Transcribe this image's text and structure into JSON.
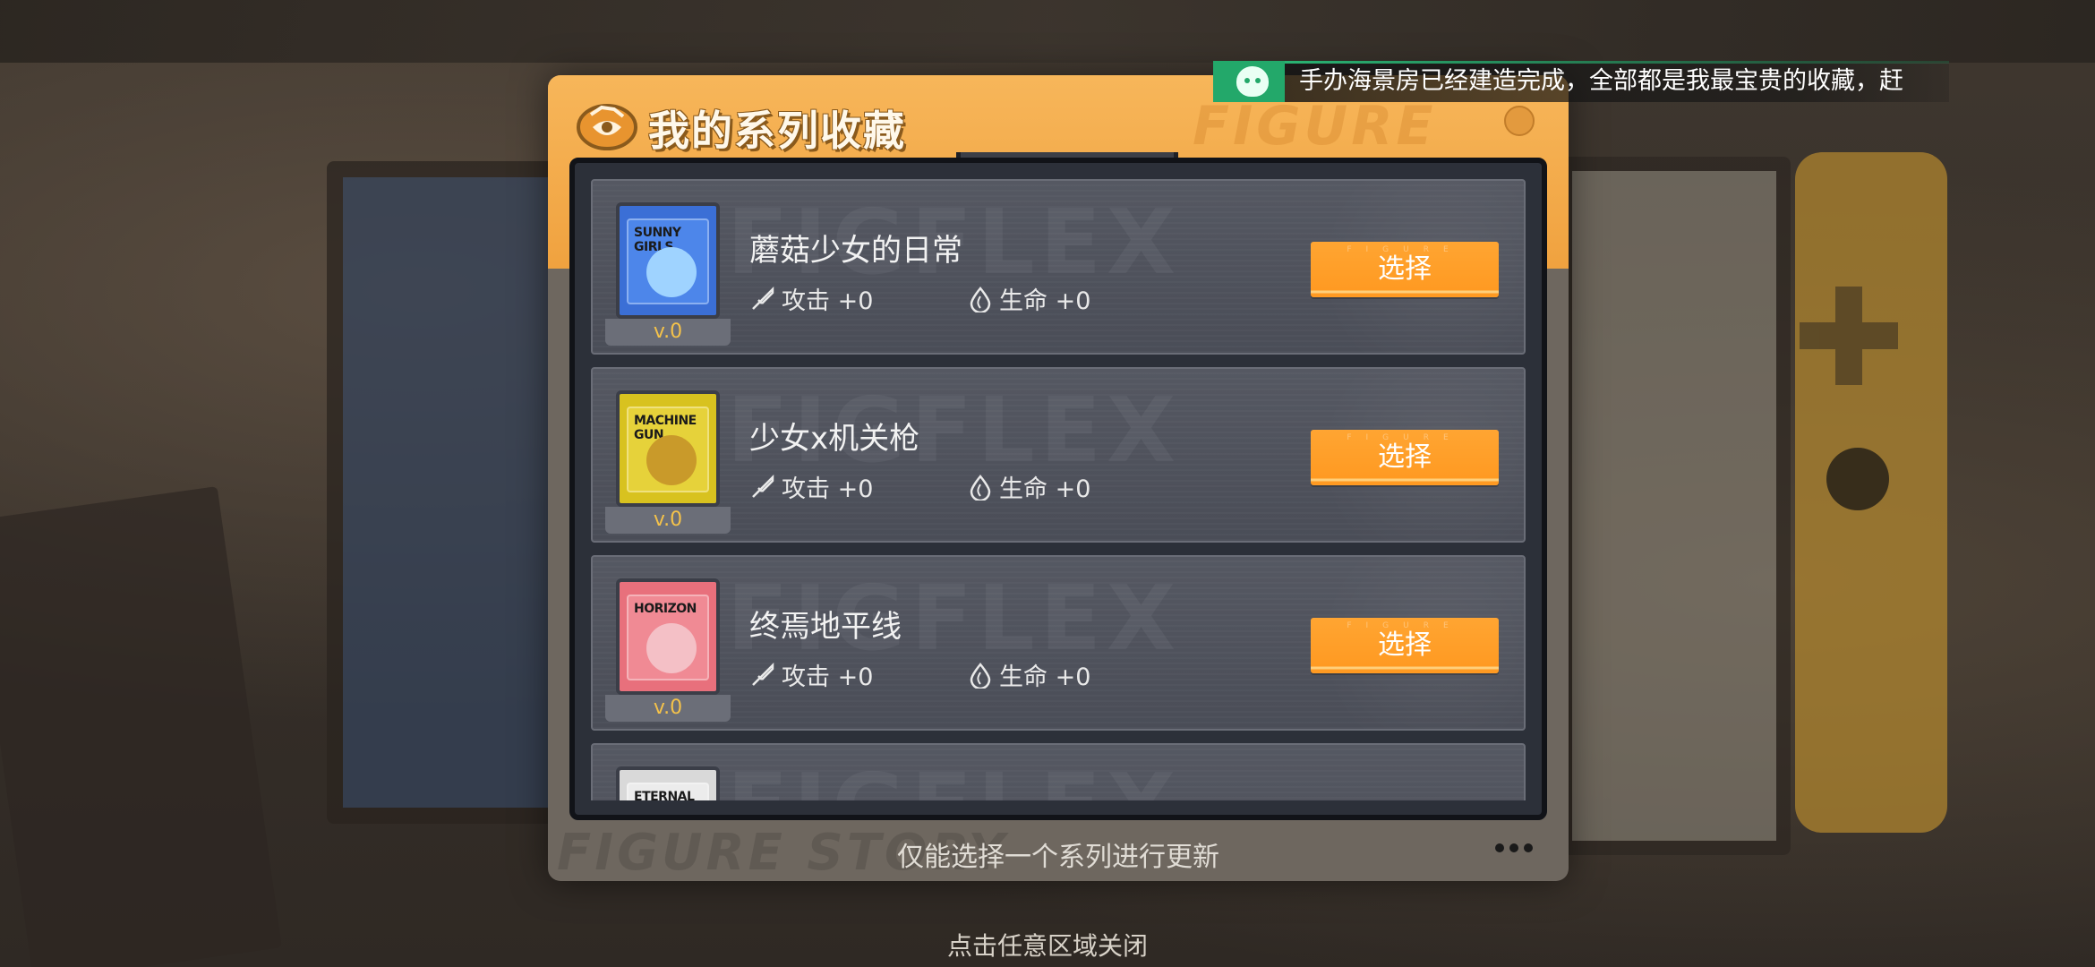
{
  "dialog": {
    "title": "我的系列收藏",
    "footer_note": "仅能选择一个系列进行更新"
  },
  "marquee": {
    "text": "手办海景房已经建造完成，全部都是我最宝贵的收藏，赶"
  },
  "close_hint": "点击任意区域关闭",
  "colors": {
    "header_orange": "#f0a23f",
    "button_orange": "#ff9a22",
    "version_gold": "#f4c24a",
    "list_bg": "#4a4d57"
  },
  "series": [
    {
      "name": "蘑菇少女的日常",
      "badge_tag": "SUNNY GIRLS",
      "badge_color": "#3b6fd6",
      "version": "v.0",
      "attack_label": "攻击 +0",
      "hp_label": "生命 +0",
      "select_label": "选择"
    },
    {
      "name": "少女x机关枪",
      "badge_tag": "MACHINE GUN",
      "badge_color": "#d8c21f",
      "version": "v.0",
      "attack_label": "攻击 +0",
      "hp_label": "生命 +0",
      "select_label": "选择"
    },
    {
      "name": "终焉地平线",
      "badge_tag": "HORIZON",
      "badge_color": "#e8707c",
      "version": "v.0",
      "attack_label": "攻击 +0",
      "hp_label": "生命 +0",
      "select_label": "选择"
    },
    {
      "badge_tag": "ETERNAL FANTASY",
      "badge_color": "#d9d9d9"
    }
  ]
}
